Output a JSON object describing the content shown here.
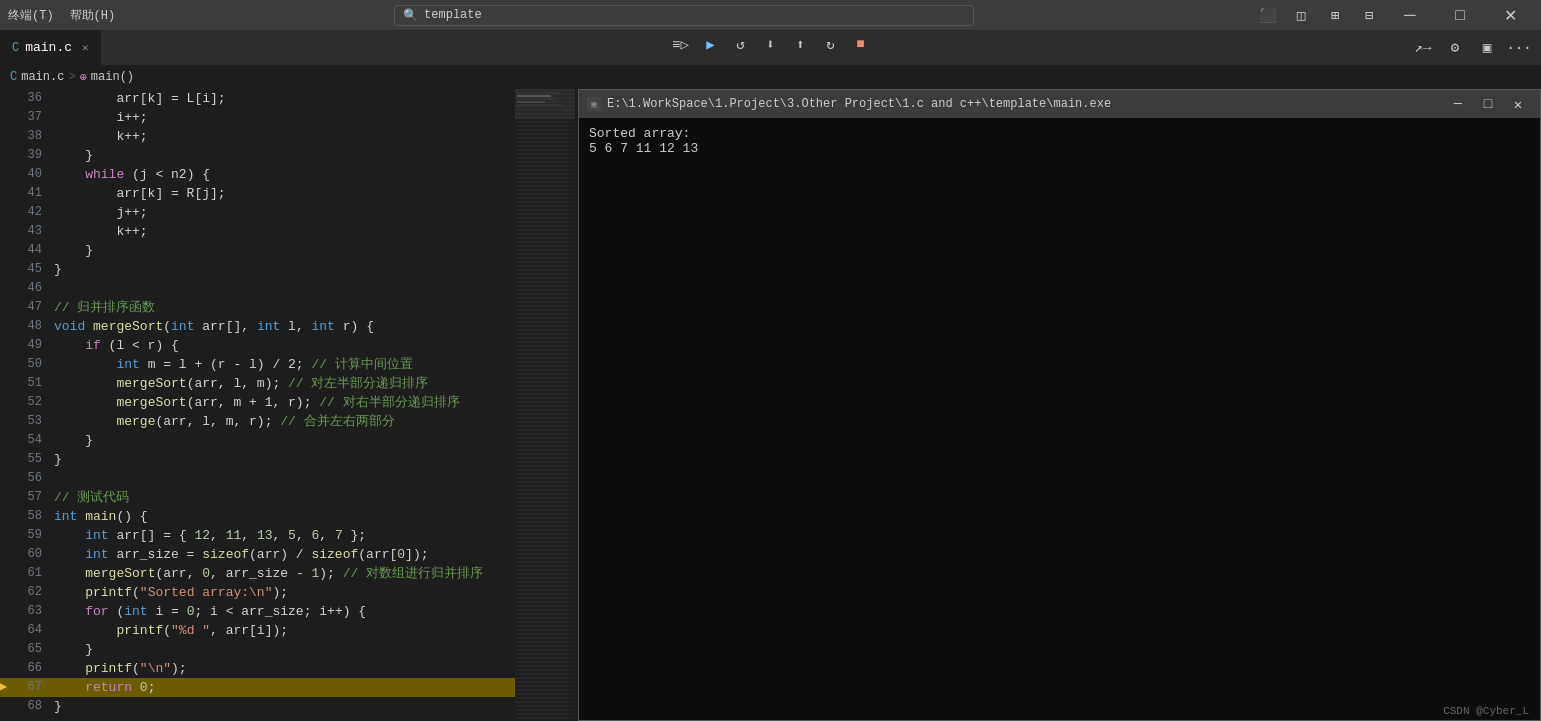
{
  "titleBar": {
    "leftItems": [
      "终端(T)",
      "帮助(H)"
    ],
    "searchText": "template",
    "searchPlaceholder": "template",
    "backIcon": "◀",
    "forwardIcon": "▶",
    "layoutIcons": [
      "▣",
      "◫",
      "⊞",
      "⊟"
    ],
    "minimizeLabel": "─",
    "maximizeLabel": "□",
    "closeLabel": "✕"
  },
  "toolbar": {
    "actions": [
      {
        "name": "run-icon",
        "label": "≡▶"
      },
      {
        "name": "continue-icon",
        "label": "▶"
      },
      {
        "name": "step-over-icon",
        "label": "↺"
      },
      {
        "name": "step-into-icon",
        "label": "↓"
      },
      {
        "name": "step-out-icon",
        "label": "↑"
      },
      {
        "name": "restart-icon",
        "label": "↻"
      },
      {
        "name": "stop-icon",
        "label": "■"
      }
    ]
  },
  "tabs": [
    {
      "label": "main.c",
      "icon": "C",
      "active": true,
      "closeable": true
    }
  ],
  "breadcrumb": {
    "items": [
      "main.c",
      ">",
      "⊕ main()"
    ]
  },
  "topRightIcons": [
    {
      "name": "run-remote-icon",
      "label": "↗→"
    },
    {
      "name": "settings-icon",
      "label": "⚙"
    },
    {
      "name": "panel-icon",
      "label": "▣"
    },
    {
      "name": "more-icon",
      "label": "···"
    }
  ],
  "codeLines": [
    {
      "num": 36,
      "arrow": false,
      "highlighted": false,
      "tokens": [
        {
          "t": "plain",
          "v": "        arr[k] = L[i];"
        }
      ]
    },
    {
      "num": 37,
      "arrow": false,
      "highlighted": false,
      "tokens": [
        {
          "t": "plain",
          "v": "        i++;"
        }
      ]
    },
    {
      "num": 38,
      "arrow": false,
      "highlighted": false,
      "tokens": [
        {
          "t": "plain",
          "v": "        k++;"
        }
      ]
    },
    {
      "num": 39,
      "arrow": false,
      "highlighted": false,
      "tokens": [
        {
          "t": "plain",
          "v": "    }"
        }
      ]
    },
    {
      "num": 40,
      "arrow": false,
      "highlighted": false,
      "tokens": [
        {
          "t": "kw",
          "v": "    while"
        },
        {
          "t": "plain",
          "v": " (j < n2) {"
        }
      ]
    },
    {
      "num": 41,
      "arrow": false,
      "highlighted": false,
      "tokens": [
        {
          "t": "plain",
          "v": "        arr[k] = R[j];"
        }
      ]
    },
    {
      "num": 42,
      "arrow": false,
      "highlighted": false,
      "tokens": [
        {
          "t": "plain",
          "v": "        j++;"
        }
      ]
    },
    {
      "num": 43,
      "arrow": false,
      "highlighted": false,
      "tokens": [
        {
          "t": "plain",
          "v": "        k++;"
        }
      ]
    },
    {
      "num": 44,
      "arrow": false,
      "highlighted": false,
      "tokens": [
        {
          "t": "plain",
          "v": "    }"
        }
      ]
    },
    {
      "num": 45,
      "arrow": false,
      "highlighted": false,
      "tokens": [
        {
          "t": "plain",
          "v": "}"
        }
      ]
    },
    {
      "num": 46,
      "arrow": false,
      "highlighted": false,
      "tokens": [
        {
          "t": "plain",
          "v": ""
        }
      ]
    },
    {
      "num": 47,
      "arrow": false,
      "highlighted": false,
      "tokens": [
        {
          "t": "cmt",
          "v": "// 归并排序函数"
        }
      ]
    },
    {
      "num": 48,
      "arrow": false,
      "highlighted": false,
      "tokens": [
        {
          "t": "kw2",
          "v": "void"
        },
        {
          "t": "plain",
          "v": " "
        },
        {
          "t": "fn",
          "v": "mergeSort"
        },
        {
          "t": "plain",
          "v": "("
        },
        {
          "t": "kw2",
          "v": "int"
        },
        {
          "t": "plain",
          "v": " arr[], "
        },
        {
          "t": "kw2",
          "v": "int"
        },
        {
          "t": "plain",
          "v": " l, "
        },
        {
          "t": "kw2",
          "v": "int"
        },
        {
          "t": "plain",
          "v": " r) {"
        }
      ]
    },
    {
      "num": 49,
      "arrow": false,
      "highlighted": false,
      "tokens": [
        {
          "t": "kw",
          "v": "    if"
        },
        {
          "t": "plain",
          "v": " (l < r) {"
        }
      ]
    },
    {
      "num": 50,
      "arrow": false,
      "highlighted": false,
      "tokens": [
        {
          "t": "kw2",
          "v": "        int"
        },
        {
          "t": "plain",
          "v": " m = l + (r - l) / 2; "
        },
        {
          "t": "cmt",
          "v": "// 计算中间位置"
        }
      ]
    },
    {
      "num": 51,
      "arrow": false,
      "highlighted": false,
      "tokens": [
        {
          "t": "plain",
          "v": "        "
        },
        {
          "t": "fn",
          "v": "mergeSort"
        },
        {
          "t": "plain",
          "v": "(arr, l, m); "
        },
        {
          "t": "cmt",
          "v": "// 对左半部分递归排序"
        }
      ]
    },
    {
      "num": 52,
      "arrow": false,
      "highlighted": false,
      "tokens": [
        {
          "t": "plain",
          "v": "        "
        },
        {
          "t": "fn",
          "v": "mergeSort"
        },
        {
          "t": "plain",
          "v": "(arr, m + 1, r); "
        },
        {
          "t": "cmt",
          "v": "// 对右半部分递归排序"
        }
      ]
    },
    {
      "num": 53,
      "arrow": false,
      "highlighted": false,
      "tokens": [
        {
          "t": "plain",
          "v": "        "
        },
        {
          "t": "fn",
          "v": "merge"
        },
        {
          "t": "plain",
          "v": "(arr, l, m, r); "
        },
        {
          "t": "cmt",
          "v": "// 合并左右两部分"
        }
      ]
    },
    {
      "num": 54,
      "arrow": false,
      "highlighted": false,
      "tokens": [
        {
          "t": "plain",
          "v": "    }"
        }
      ]
    },
    {
      "num": 55,
      "arrow": false,
      "highlighted": false,
      "tokens": [
        {
          "t": "plain",
          "v": "}"
        }
      ]
    },
    {
      "num": 56,
      "arrow": false,
      "highlighted": false,
      "tokens": [
        {
          "t": "plain",
          "v": ""
        }
      ]
    },
    {
      "num": 57,
      "arrow": false,
      "highlighted": false,
      "tokens": [
        {
          "t": "cmt",
          "v": "// 测试代码"
        }
      ]
    },
    {
      "num": 58,
      "arrow": false,
      "highlighted": false,
      "tokens": [
        {
          "t": "kw2",
          "v": "int"
        },
        {
          "t": "plain",
          "v": " "
        },
        {
          "t": "fn",
          "v": "main"
        },
        {
          "t": "plain",
          "v": "() {"
        }
      ]
    },
    {
      "num": 59,
      "arrow": false,
      "highlighted": false,
      "tokens": [
        {
          "t": "kw2",
          "v": "    int"
        },
        {
          "t": "plain",
          "v": " arr[] = { "
        },
        {
          "t": "num",
          "v": "12"
        },
        {
          "t": "plain",
          "v": ", "
        },
        {
          "t": "num",
          "v": "11"
        },
        {
          "t": "plain",
          "v": ", "
        },
        {
          "t": "num",
          "v": "13"
        },
        {
          "t": "plain",
          "v": ", "
        },
        {
          "t": "num",
          "v": "5"
        },
        {
          "t": "plain",
          "v": ", "
        },
        {
          "t": "num",
          "v": "6"
        },
        {
          "t": "plain",
          "v": ", "
        },
        {
          "t": "num",
          "v": "7"
        },
        {
          "t": "plain",
          "v": " };"
        }
      ]
    },
    {
      "num": 60,
      "arrow": false,
      "highlighted": false,
      "tokens": [
        {
          "t": "kw2",
          "v": "    int"
        },
        {
          "t": "plain",
          "v": " arr_size = "
        },
        {
          "t": "fn",
          "v": "sizeof"
        },
        {
          "t": "plain",
          "v": "(arr) / "
        },
        {
          "t": "fn",
          "v": "sizeof"
        },
        {
          "t": "plain",
          "v": "(arr["
        },
        {
          "t": "num",
          "v": "0"
        },
        {
          "t": "plain",
          "v": "]);"
        }
      ]
    },
    {
      "num": 61,
      "arrow": false,
      "highlighted": false,
      "tokens": [
        {
          "t": "plain",
          "v": "    "
        },
        {
          "t": "fn",
          "v": "mergeSort"
        },
        {
          "t": "plain",
          "v": "(arr, "
        },
        {
          "t": "num",
          "v": "0"
        },
        {
          "t": "plain",
          "v": ", arr_size - "
        },
        {
          "t": "num",
          "v": "1"
        },
        {
          "t": "plain",
          "v": "); "
        },
        {
          "t": "cmt",
          "v": "// 对数组进行归并排序"
        }
      ]
    },
    {
      "num": 62,
      "arrow": false,
      "highlighted": false,
      "tokens": [
        {
          "t": "plain",
          "v": "    "
        },
        {
          "t": "fn",
          "v": "printf"
        },
        {
          "t": "plain",
          "v": "("
        },
        {
          "t": "str",
          "v": "\"Sorted array:\\n\""
        },
        {
          "t": "plain",
          "v": ");"
        }
      ]
    },
    {
      "num": 63,
      "arrow": false,
      "highlighted": false,
      "tokens": [
        {
          "t": "kw",
          "v": "    for"
        },
        {
          "t": "plain",
          "v": " ("
        },
        {
          "t": "kw2",
          "v": "int"
        },
        {
          "t": "plain",
          "v": " i = "
        },
        {
          "t": "num",
          "v": "0"
        },
        {
          "t": "plain",
          "v": "; i < arr_size; i++) {"
        }
      ]
    },
    {
      "num": 64,
      "arrow": false,
      "highlighted": false,
      "tokens": [
        {
          "t": "plain",
          "v": "        "
        },
        {
          "t": "fn",
          "v": "printf"
        },
        {
          "t": "plain",
          "v": "("
        },
        {
          "t": "str",
          "v": "\"%d \""
        },
        {
          "t": "plain",
          "v": ", arr[i]);"
        }
      ]
    },
    {
      "num": 65,
      "arrow": false,
      "highlighted": false,
      "tokens": [
        {
          "t": "plain",
          "v": "    }"
        }
      ]
    },
    {
      "num": 66,
      "arrow": false,
      "highlighted": false,
      "tokens": [
        {
          "t": "plain",
          "v": "    "
        },
        {
          "t": "fn",
          "v": "printf"
        },
        {
          "t": "plain",
          "v": "("
        },
        {
          "t": "str",
          "v": "\"\\n\""
        },
        {
          "t": "plain",
          "v": ");"
        }
      ]
    },
    {
      "num": 67,
      "arrow": true,
      "highlighted": true,
      "tokens": [
        {
          "t": "kw",
          "v": "    return"
        },
        {
          "t": "plain",
          "v": " "
        },
        {
          "t": "num",
          "v": "0"
        },
        {
          "t": "plain",
          "v": ";"
        }
      ]
    },
    {
      "num": 68,
      "arrow": false,
      "highlighted": false,
      "tokens": [
        {
          "t": "plain",
          "v": "}"
        }
      ]
    }
  ],
  "terminal": {
    "title": "E:\\1.WorkSpace\\1.Project\\3.Other Project\\1.c and c++\\template\\main.exe",
    "output": [
      "Sorted array:",
      "5 6 7 11 12 13"
    ],
    "minimizeLabel": "─",
    "maximizeLabel": "□",
    "closeLabel": "✕"
  },
  "watermark": {
    "text": "CSDN @Cyber_L"
  }
}
